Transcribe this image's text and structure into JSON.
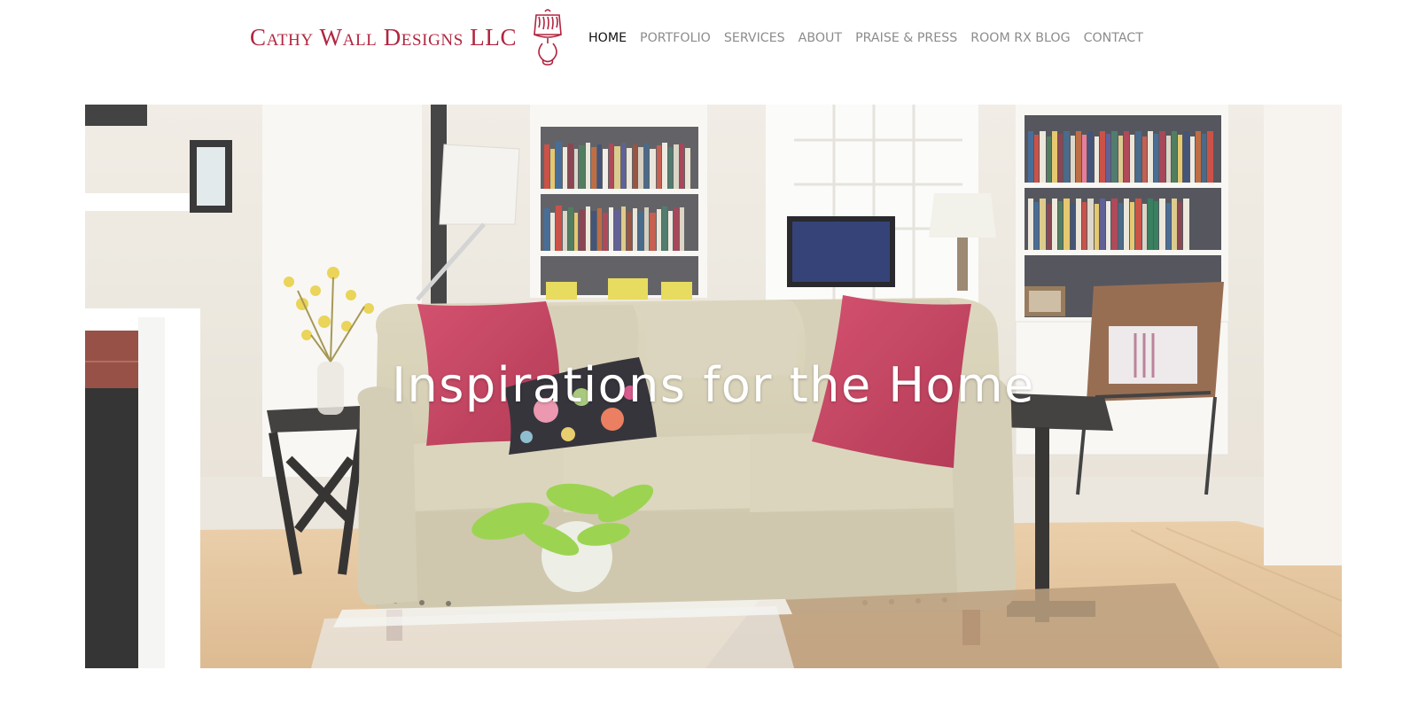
{
  "brand": {
    "name": "Cathy Wall Designs LLC",
    "color": "#b1253f"
  },
  "nav": {
    "items": [
      {
        "label": "Home",
        "active": true
      },
      {
        "label": "Portfolio",
        "active": false
      },
      {
        "label": "Services",
        "active": false
      },
      {
        "label": "About",
        "active": false
      },
      {
        "label": "Praise & Press",
        "active": false
      },
      {
        "label": "Room Rx Blog",
        "active": false
      },
      {
        "label": "Contact",
        "active": false
      }
    ]
  },
  "hero": {
    "title": "Inspirations for the Home",
    "image": "living-room-photo"
  }
}
